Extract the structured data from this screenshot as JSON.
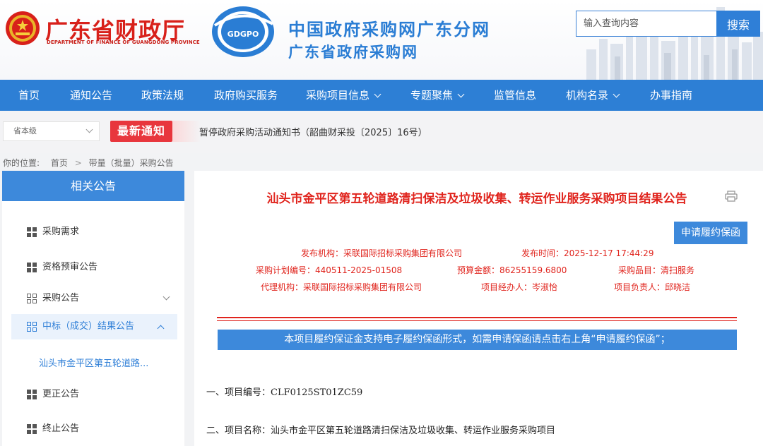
{
  "header": {
    "dept_name_cn": "广东省财政厅",
    "dept_name_en": "DEPARTMENT OF FINANCE OF GUANGDONG PROVINCE",
    "logo_text": "GDGPO",
    "site_title": "中国政府采购网广东分网",
    "site_subtitle": "广东省政府采购网",
    "search": {
      "placeholder": "输入查询内容",
      "button_label": "搜索"
    }
  },
  "nav": {
    "items": [
      {
        "label": "首页",
        "has_dropdown": false
      },
      {
        "label": "通知公告",
        "has_dropdown": false
      },
      {
        "label": "政策法规",
        "has_dropdown": false
      },
      {
        "label": "政府购买服务",
        "has_dropdown": false
      },
      {
        "label": "采购项目信息",
        "has_dropdown": true
      },
      {
        "label": "专题聚焦",
        "has_dropdown": true
      },
      {
        "label": "监管信息",
        "has_dropdown": false
      },
      {
        "label": "机构名录",
        "has_dropdown": true
      },
      {
        "label": "办事指南",
        "has_dropdown": false
      }
    ]
  },
  "notice_bar": {
    "level_select": "省本级",
    "badge": "最新通知",
    "text": "暂停政府采购活动通知书（韶曲财采投〔2025〕16号）"
  },
  "breadcrumb": {
    "prefix": "你的位置:",
    "items": [
      "首页",
      "带量（批量）采购公告"
    ]
  },
  "sidebar": {
    "title": "相关公告",
    "items": [
      {
        "label": "采购需求",
        "icon": "grid-filled-icon"
      },
      {
        "label": "资格预审公告",
        "icon": "grid-filled-icon"
      },
      {
        "label": "采购公告",
        "icon": "grid-outline-icon",
        "expanded": false
      },
      {
        "label": "中标（成交）结果公告",
        "icon": "grid-outline-icon",
        "expanded": true
      },
      {
        "label": "更正公告",
        "icon": "grid-filled-icon"
      },
      {
        "label": "终止公告",
        "icon": "grid-filled-icon"
      }
    ],
    "sub_item": "汕头市金平区第五轮道路..."
  },
  "article": {
    "title": "汕头市金平区第五轮道路清扫保洁及垃圾收集、转运作业服务采购项目结果公告",
    "apply_button": "申请履约保函",
    "meta": {
      "publisher": "发布机构：采联国际招标采购集团有限公司",
      "publish_time": "发布时间：2025-12-17 17:44:29",
      "plan_no": "采购计划编号：440511-2025-01508",
      "budget": "预算金额：86255159.6800",
      "category": "采购品目：清扫服务",
      "agency": "代理机构：采联国际招标采购集团有限公司",
      "manager": "项目经办人：岑淑怡",
      "leader": "项目负责人：邱晓洁"
    },
    "tip": "本项目履约保证金支持电子履约保函形式，如需申请保函请点击右上角“申请履约保函”；",
    "lines": [
      "一、项目编号：CLF0125ST01ZC59",
      "二、项目名称：汕头市金平区第五轮道路清扫保洁及垃圾收集、转运作业服务采购项目"
    ]
  },
  "colors": {
    "primary_blue": "#2d7fd5",
    "accent_red": "#e0241d",
    "badge_red": "#e8363d"
  }
}
